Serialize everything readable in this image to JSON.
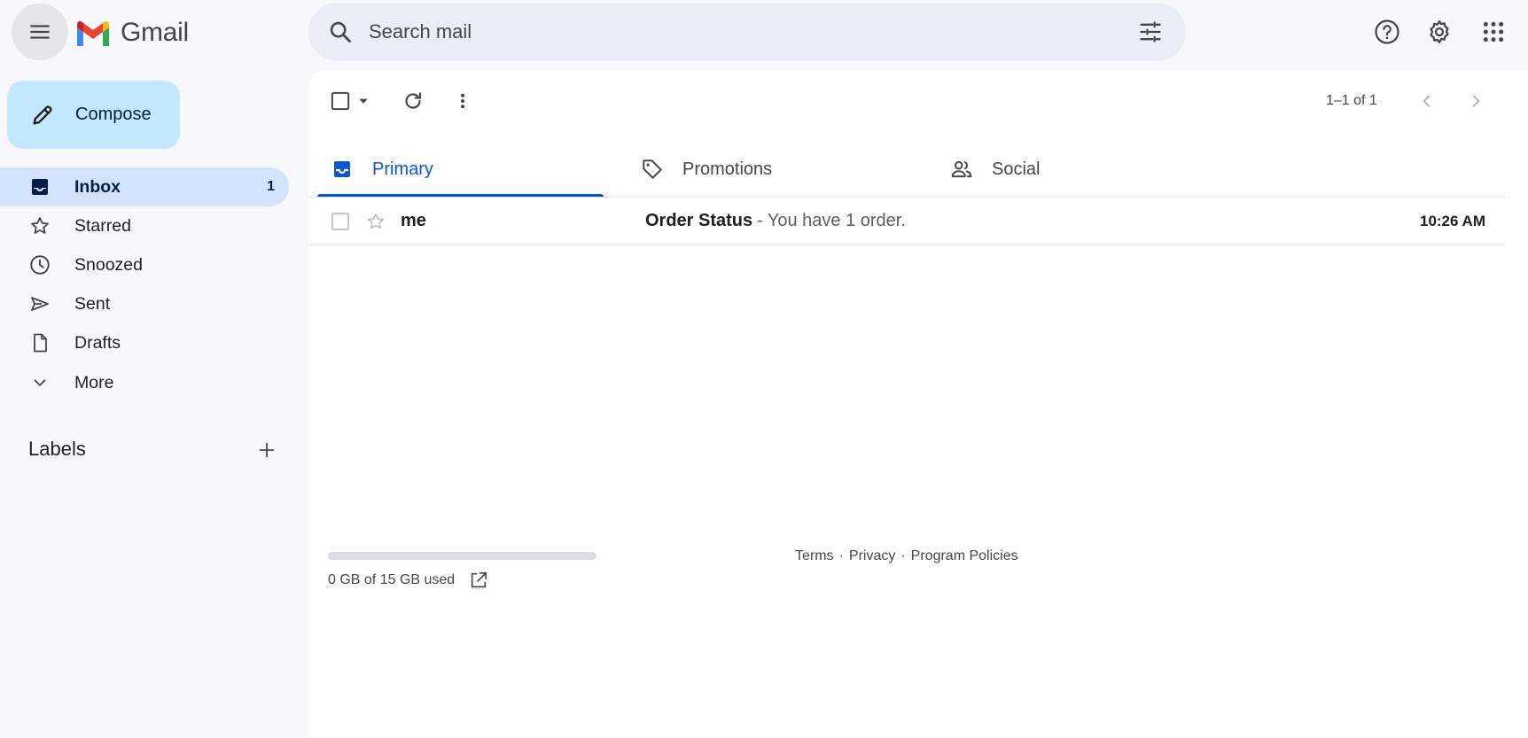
{
  "app": {
    "name": "Gmail"
  },
  "header": {
    "search_placeholder": "Search mail"
  },
  "sidebar": {
    "compose_label": "Compose",
    "items": [
      {
        "label": "Inbox",
        "count": "1",
        "active": true,
        "icon": "inbox-icon"
      },
      {
        "label": "Starred",
        "count": "",
        "active": false,
        "icon": "star-icon"
      },
      {
        "label": "Snoozed",
        "count": "",
        "active": false,
        "icon": "clock-icon"
      },
      {
        "label": "Sent",
        "count": "",
        "active": false,
        "icon": "send-icon"
      },
      {
        "label": "Drafts",
        "count": "",
        "active": false,
        "icon": "draft-icon"
      },
      {
        "label": "More",
        "count": "",
        "active": false,
        "icon": "chevron-down-icon"
      }
    ],
    "labels_title": "Labels"
  },
  "toolbar": {
    "pagination": "1–1 of 1"
  },
  "tabs": [
    {
      "label": "Primary",
      "active": true,
      "icon": "inbox-icon"
    },
    {
      "label": "Promotions",
      "active": false,
      "icon": "tag-icon"
    },
    {
      "label": "Social",
      "active": false,
      "icon": "people-icon"
    }
  ],
  "emails": [
    {
      "sender": "me",
      "subject": "Order Status",
      "snippet": "- You have 1 order.",
      "time": "10:26 AM",
      "unread": true,
      "starred": false
    }
  ],
  "footer": {
    "storage_text": "0 GB of 15 GB used",
    "storage_used_fraction": 0,
    "links": [
      "Terms",
      "·",
      "Privacy",
      "·",
      "Program Policies"
    ]
  },
  "colors": {
    "accent": "#0b57d0",
    "compose_bg": "#c2e7ff",
    "active_nav_bg": "#d3e3fd",
    "page_bg": "#f6f8fc"
  }
}
